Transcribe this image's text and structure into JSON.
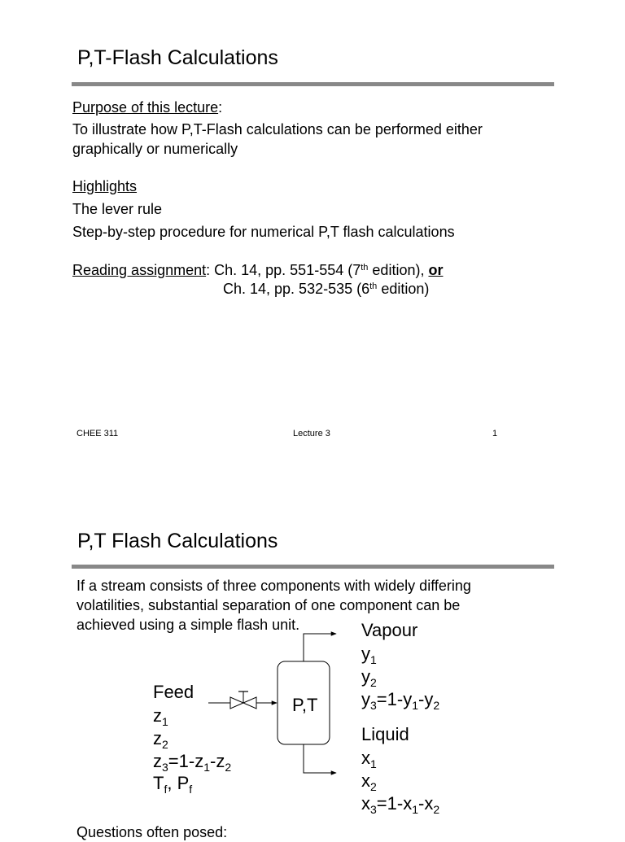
{
  "slide1": {
    "title": "P,T-Flash Calculations",
    "purpose_heading": "Purpose of this lecture",
    "purpose_colon": ":",
    "purpose_line1": "To illustrate how P,T-Flash calculations can be performed either",
    "purpose_line2": "graphically or numerically",
    "highlights_heading": "Highlights",
    "highlights": [
      "The lever rule",
      "Step-by-step procedure for numerical P,T flash calculations"
    ],
    "reading_heading": "Reading assignment",
    "reading_line1_pre": ": Ch. 14, pp. 551-554 (7",
    "reading_line1_sup": "th",
    "reading_line1_post": " edition), ",
    "reading_line1_or": "or",
    "reading_line2_pre": "Ch. 14, pp. 532-535 (6",
    "reading_line2_sup": "th",
    "reading_line2_post": " edition)",
    "footer": {
      "course": "CHEE 311",
      "lecture": "Lecture 3",
      "page": "1"
    }
  },
  "slide2": {
    "title": "P,T Flash Calculations",
    "intro_lines": [
      "If a stream consists of three components with widely differing",
      "volatilities, substantial separation of one component can be",
      "achieved using a simple flash unit."
    ],
    "diagram": {
      "vessel_label": "P,T",
      "feed": {
        "heading": "Feed",
        "lines": [
          {
            "base": "z",
            "sub": "1"
          },
          {
            "base": "z",
            "sub": "2"
          }
        ],
        "z3": {
          "a": "z",
          "a_sub": "3",
          "mid": "=1-",
          "b": "z",
          "b_sub": "1",
          "dash": "-",
          "c": "z",
          "c_sub": "2"
        },
        "tp": {
          "t": "T",
          "t_sub": "f",
          "sep": ", ",
          "p": "P",
          "p_sub": "f"
        }
      },
      "vapour": {
        "heading": "Vapour",
        "lines": [
          {
            "base": "y",
            "sub": "1"
          },
          {
            "base": "y",
            "sub": "2"
          }
        ],
        "y3": {
          "a": "y",
          "a_sub": "3",
          "mid": "=1-",
          "b": "y",
          "b_sub": "1",
          "dash": "-",
          "c": "y",
          "c_sub": "2"
        }
      },
      "liquid": {
        "heading": "Liquid",
        "lines": [
          {
            "base": "x",
            "sub": "1"
          },
          {
            "base": "x",
            "sub": "2"
          }
        ],
        "x3": {
          "a": "x",
          "a_sub": "3",
          "mid": "=1-",
          "b": "x",
          "b_sub": "1",
          "dash": "-",
          "c": "x",
          "c_sub": "2"
        }
      }
    },
    "questions_heading": "Questions often posed:"
  }
}
